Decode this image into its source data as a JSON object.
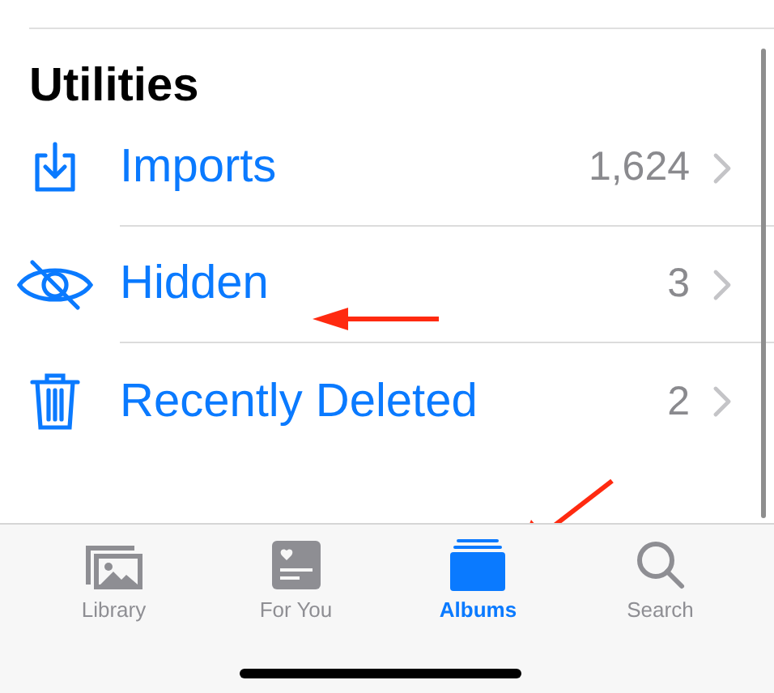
{
  "section": {
    "title": "Utilities"
  },
  "rows": [
    {
      "kind": "imports",
      "label": "Imports",
      "count": "1,624"
    },
    {
      "kind": "hidden",
      "label": "Hidden",
      "count": "3"
    },
    {
      "kind": "trash",
      "label": "Recently Deleted",
      "count": "2"
    }
  ],
  "tabs": [
    {
      "kind": "library",
      "label": "Library",
      "selected": false
    },
    {
      "kind": "foryou",
      "label": "For You",
      "selected": false
    },
    {
      "kind": "albums",
      "label": "Albums",
      "selected": true
    },
    {
      "kind": "search",
      "label": "Search",
      "selected": false
    }
  ]
}
